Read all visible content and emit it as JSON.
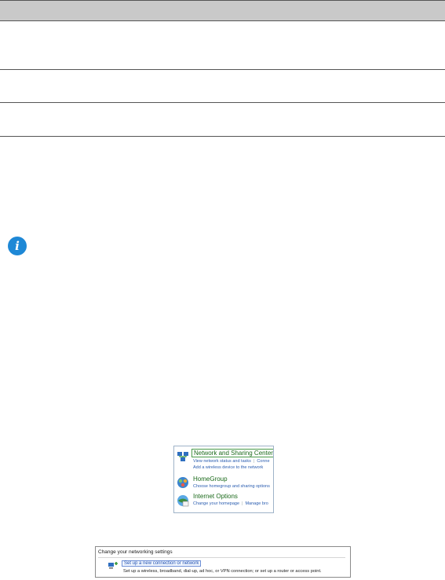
{
  "control_panel": {
    "items": [
      {
        "title": "Network and Sharing Center",
        "links": [
          "View network status and tasks",
          "Conne"
        ],
        "extra_link": "Add a wireless device to the network",
        "icon": "network-sharing-icon"
      },
      {
        "title": "HomeGroup",
        "links": [
          "Choose homegroup and sharing options"
        ],
        "icon": "homegroup-icon"
      },
      {
        "title": "Internet Options",
        "links": [
          "Change your homepage",
          "Manage bro"
        ],
        "icon": "internet-options-icon"
      }
    ]
  },
  "network_settings": {
    "heading": "Change your networking settings",
    "link": "Set up a new connection or network",
    "description": "Set up a wireless, broadband, dial-up, ad hoc, or VPN connection; or set up a router or access point.",
    "icon": "new-connection-icon"
  },
  "colors": {
    "accent": "#1e88d6",
    "table_header": "#c9c9c9",
    "link": "#2a5db0",
    "title_green": "#1b6a1b"
  }
}
